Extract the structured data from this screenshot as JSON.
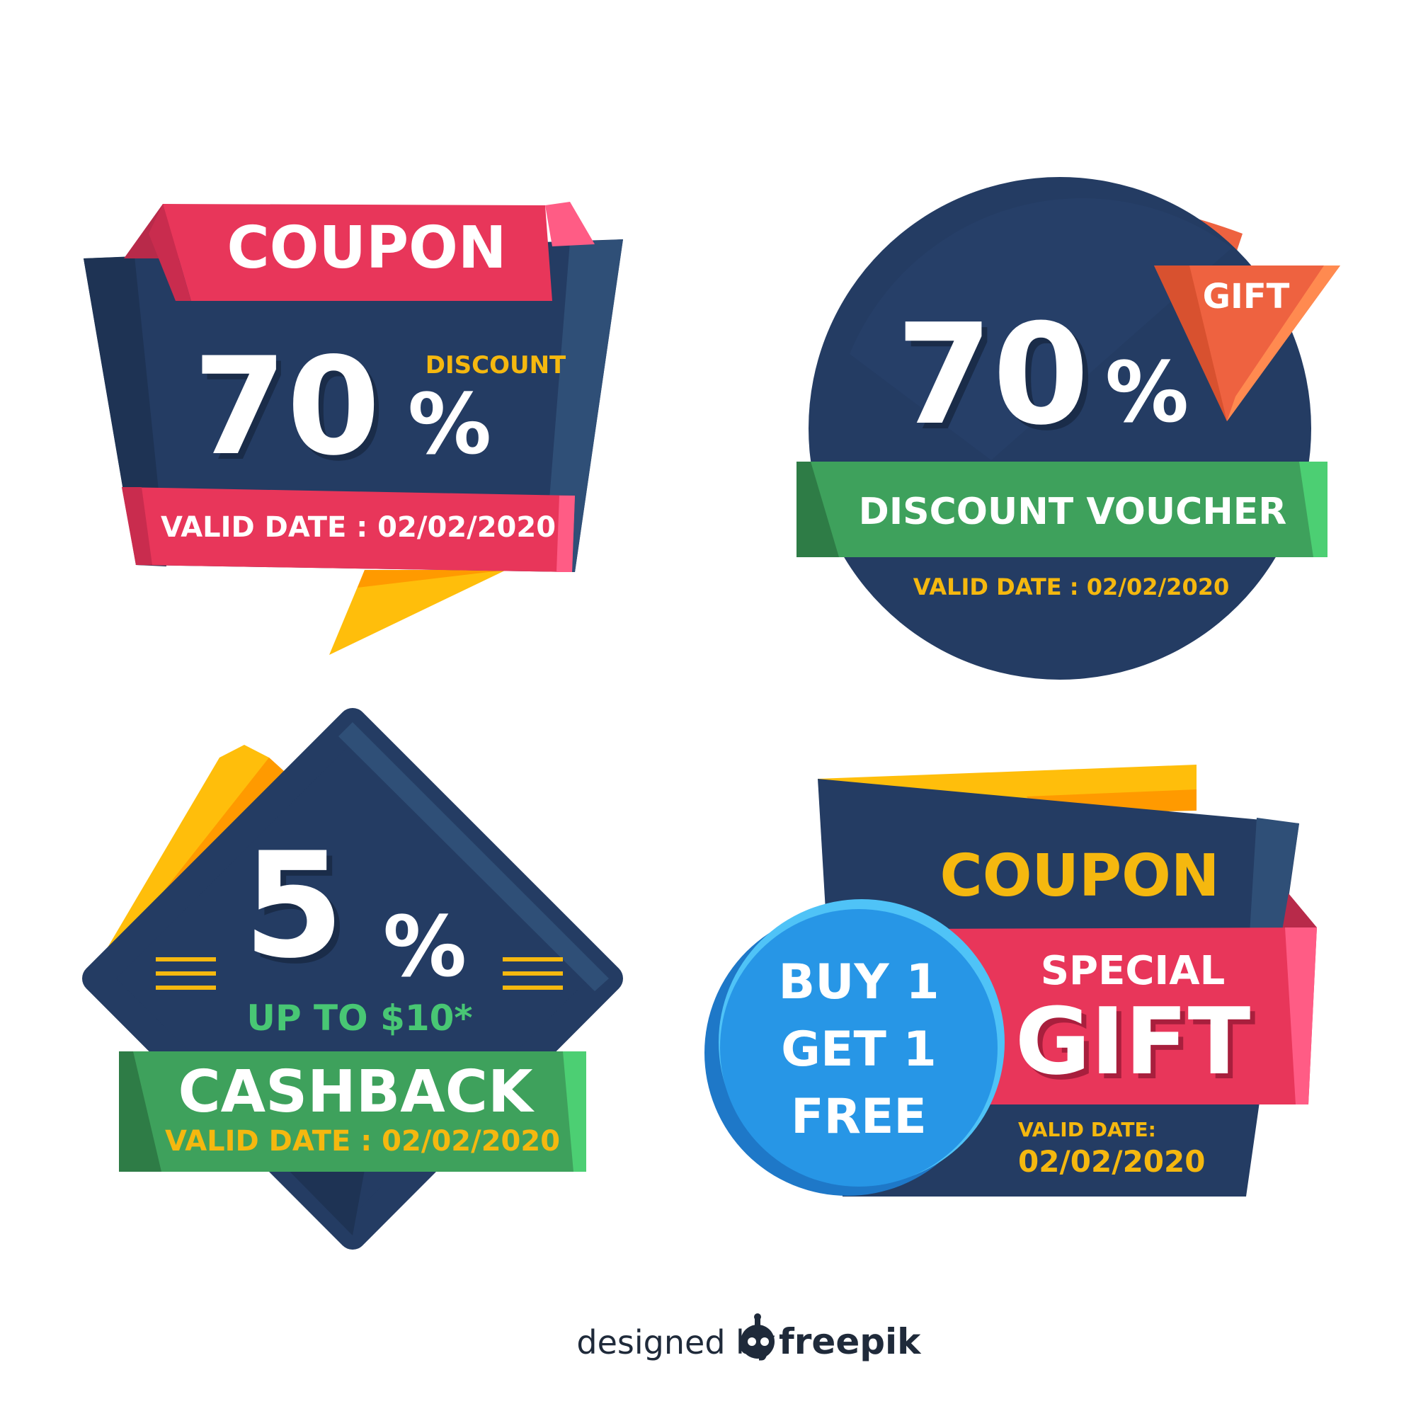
{
  "colors": {
    "navy": "#243c63",
    "navy_light": "#2f4f77",
    "navy_dark": "#1e3354",
    "pink": "#e8365a",
    "pink_light": "#ff5c85",
    "pink_dark": "#b82a4a",
    "yellow": "#ffbe0b",
    "orange": "#ff9a00",
    "coral": "#ee6240",
    "coral_light": "#ff8a50",
    "green": "#3ea15c",
    "green_light": "#4ccf73",
    "green_dark": "#2e7c46",
    "blue": "#2796e6",
    "blue_light": "#4fc3f7",
    "white": "#ffffff",
    "text_yellow": "#f5b80f",
    "text_green": "#48c774"
  },
  "badge1": {
    "title": "COUPON",
    "number": "70",
    "percent": "%",
    "discount": "DISCOUNT",
    "valid": "VALID DATE : 02/02/2020"
  },
  "badge2": {
    "number": "70",
    "percent": "%",
    "gift": "GIFT",
    "ribbon": "DISCOUNT VOUCHER",
    "valid": "VALID DATE : 02/02/2020"
  },
  "badge3": {
    "number": "5",
    "percent": "%",
    "upto": "UP TO $10*",
    "ribbon": "CASHBACK",
    "valid": "VALID DATE : 02/02/2020"
  },
  "badge4": {
    "title": "COUPON",
    "special": "SPECIAL",
    "gift": "GIFT",
    "buy": "BUY 1",
    "get": "GET 1",
    "free": "FREE",
    "valid_label": "VALID DATE:",
    "valid_date": "02/02/2020"
  },
  "footer": {
    "designed_by": "designed by",
    "brand": "freepik",
    "logo_icon": "freepik-robot-icon"
  }
}
